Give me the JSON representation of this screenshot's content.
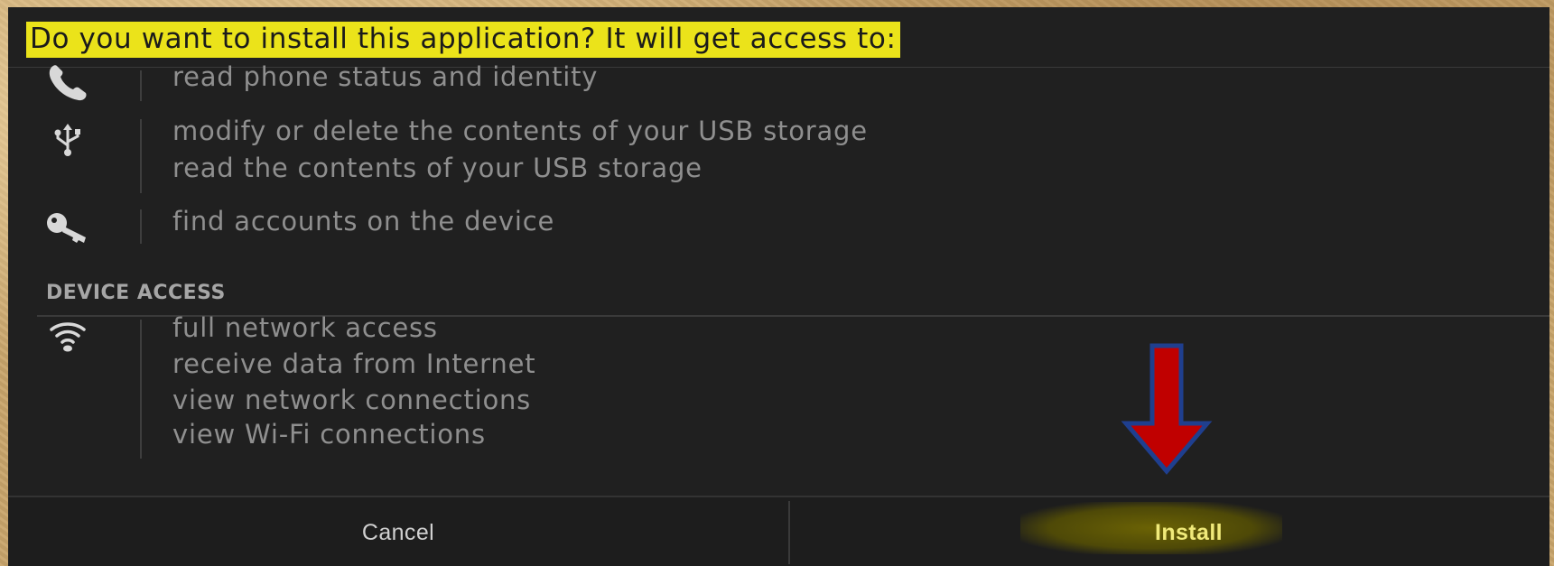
{
  "dialog": {
    "title": "Do you want to install this application? It will get access to:",
    "groups": [
      {
        "icon": "phone-icon",
        "items": [
          "read phone status and identity"
        ]
      },
      {
        "icon": "usb-icon",
        "items": [
          "modify or delete the contents of your USB storage",
          "read the contents of your USB storage"
        ]
      },
      {
        "icon": "key-icon",
        "items": [
          "find accounts on the device"
        ]
      }
    ],
    "section_header": "DEVICE ACCESS",
    "network_group": {
      "icon": "wifi-icon",
      "items": [
        "full network access",
        "receive data from Internet",
        "view network connections",
        "view Wi-Fi connections"
      ]
    },
    "buttons": {
      "cancel": "Cancel",
      "install": "Install"
    }
  },
  "annotation": {
    "arrow_color": "#c00000",
    "arrow_outline": "#1f3f8f",
    "highlight_color": "#ebe31a"
  }
}
